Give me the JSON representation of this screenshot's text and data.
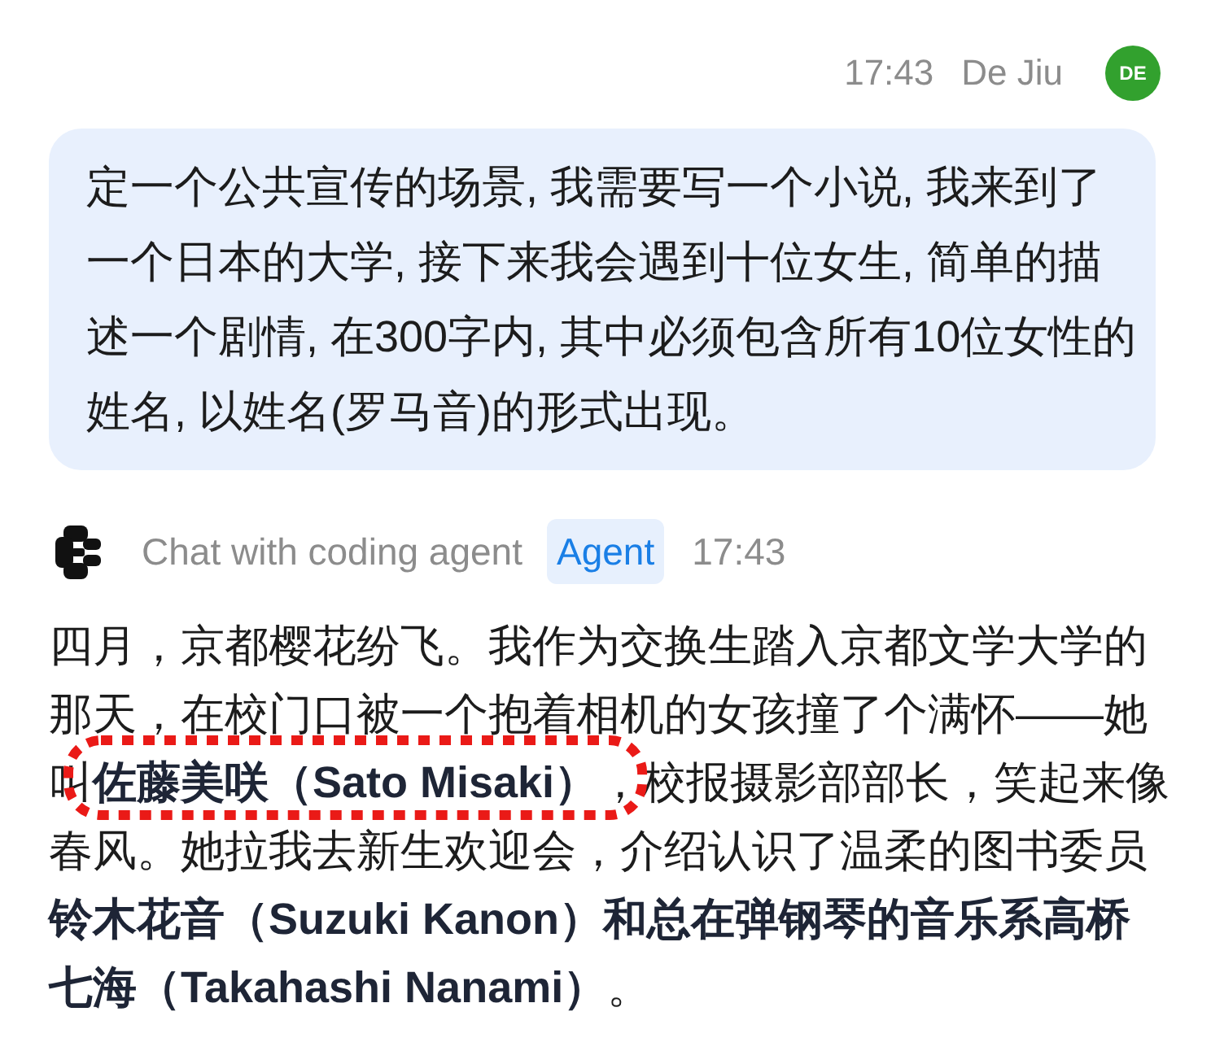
{
  "user_message": {
    "time": "17:43",
    "author": "De Jiu",
    "avatar_initials": "DE",
    "text": "定一个公共宣传的场景, 我需要写一个小说, 我来到了一个日本的大学, 接下来我会遇到十位女生, 简单的描述一个剧情, 在300字内, 其中必须包含所有10位女性的姓名, 以姓名(罗马音)的形式出现。"
  },
  "agent_message": {
    "name": "Chat with coding agent",
    "badge": "Agent",
    "time": "17:43",
    "story": {
      "segments": [
        {
          "text": "四月，京都樱花纷飞。我作为交换生踏入京都文学大学的那天，在校门口被一个抱着相机的女孩撞了个满怀——她叫",
          "circled": false
        },
        {
          "text": "**佐藤美咲（Sato Misaki）**，",
          "circled": true
        },
        {
          "text": "校报摄影部部长，笑起来像春风。她拉我去新生欢迎会，介绍认识了温柔的图书委员**铃木花音（Suzuki Kanon）和总在弹钢琴的音乐系高桥七海（Takahashi Nanami）**。",
          "circled": false
        }
      ]
    }
  }
}
